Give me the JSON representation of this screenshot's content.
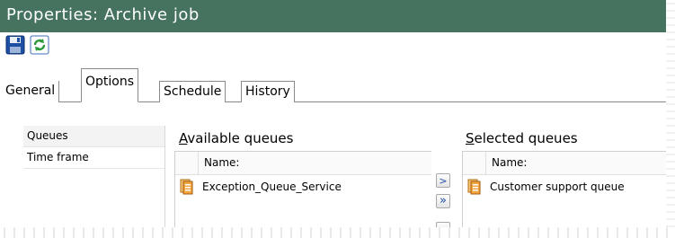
{
  "window": {
    "title": "Properties: Archive job",
    "title_bar_color": "#45735f"
  },
  "toolbar": {
    "buttons": [
      {
        "name": "save",
        "icon": "floppy-disk-icon"
      },
      {
        "name": "refresh",
        "icon": "refresh-icon"
      }
    ]
  },
  "tabs": [
    {
      "label": "General",
      "active": false
    },
    {
      "label": "Options",
      "active": true
    },
    {
      "label": "Schedule",
      "active": false
    },
    {
      "label": "History",
      "active": false
    }
  ],
  "nav": {
    "items": [
      {
        "label": "Queues",
        "selected": true
      },
      {
        "label": "Time frame",
        "selected": false
      }
    ]
  },
  "available": {
    "label_prefix": "A",
    "label_rest": "vailable queues",
    "column_header": "Name:",
    "rows": [
      {
        "name": "Exception_Queue_Service",
        "icon": "queue-icon"
      }
    ]
  },
  "selected": {
    "label_prefix": "S",
    "label_rest": "elected queues",
    "column_header": "Name:",
    "rows": [
      {
        "name": "Customer support queue",
        "icon": "queue-icon"
      }
    ]
  },
  "move_buttons": {
    "add_one": ">",
    "add_all": "»",
    "remove_one": "<"
  }
}
